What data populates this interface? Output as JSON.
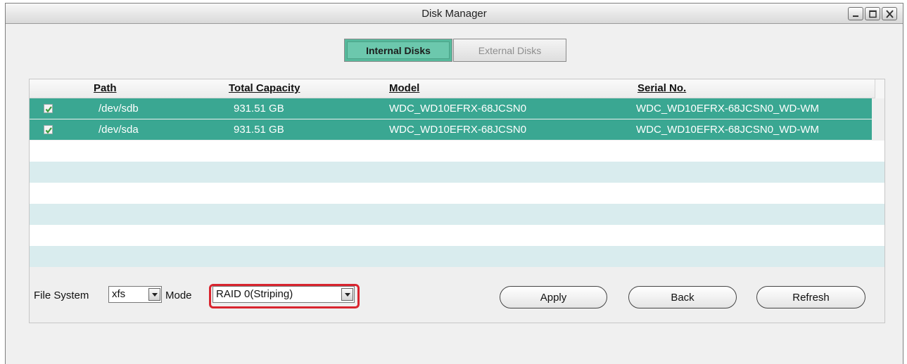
{
  "window": {
    "title": "Disk Manager"
  },
  "tabs": [
    {
      "label": "Internal Disks",
      "active": true
    },
    {
      "label": "External Disks",
      "active": false
    }
  ],
  "table": {
    "columns": [
      "Path",
      "Total Capacity",
      "Model",
      "Serial No."
    ],
    "rows": [
      {
        "checked": true,
        "path": "/dev/sdb",
        "capacity": "931.51 GB",
        "model": "WDC_WD10EFRX-68JCSN0",
        "serial": "WDC_WD10EFRX-68JCSN0_WD-WM"
      },
      {
        "checked": true,
        "path": "/dev/sda",
        "capacity": "931.51 GB",
        "model": "WDC_WD10EFRX-68JCSN0",
        "serial": "WDC_WD10EFRX-68JCSN0_WD-WM"
      }
    ]
  },
  "controls": {
    "file_system_label": "File System",
    "file_system_value": "xfs",
    "mode_label": "Mode",
    "mode_value": "RAID 0(Striping)",
    "apply_label": "Apply",
    "back_label": "Back",
    "refresh_label": "Refresh"
  },
  "colors": {
    "selected_row": "#3aa792",
    "active_tab": "#6cc8ad",
    "highlight": "#d9252f",
    "alt_row": "#d9ecee"
  }
}
